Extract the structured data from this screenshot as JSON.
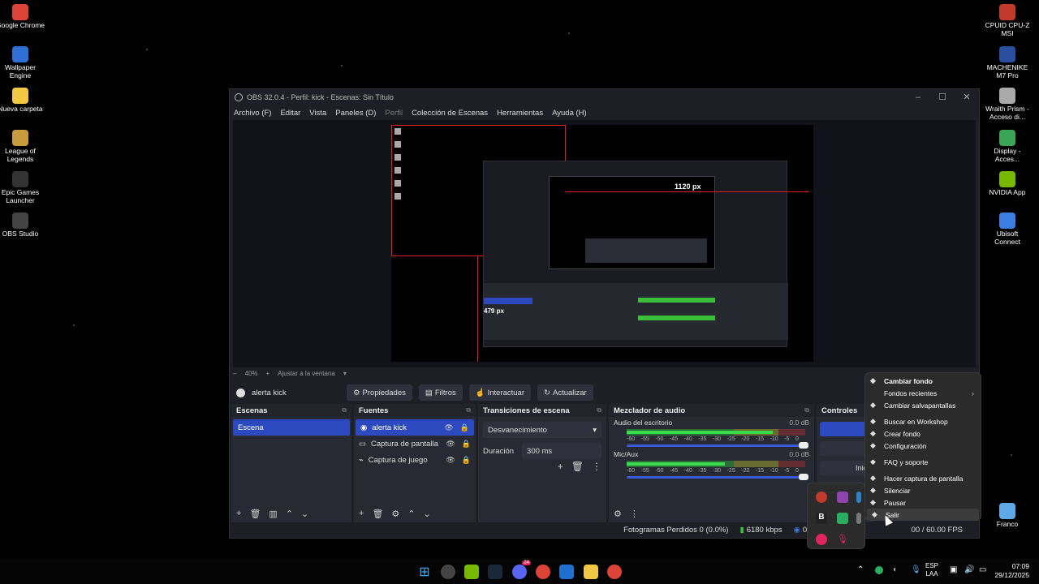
{
  "desktop_left": [
    {
      "label": "Google Chrome",
      "icon": "chrome-icon",
      "color": "#db4437"
    },
    {
      "label": "Wallpaper Engine",
      "icon": "wallpaper-engine-icon",
      "color": "#2f6fd6"
    },
    {
      "label": "Nueva carpeta",
      "icon": "folder-icon",
      "color": "#f2c744"
    },
    {
      "label": "League of Legends",
      "icon": "league-icon",
      "color": "#c89b3c"
    },
    {
      "label": "Epic Games Launcher",
      "icon": "epic-games-icon",
      "color": "#333333"
    },
    {
      "label": "OBS Studio",
      "icon": "obs-icon",
      "color": "#444444"
    }
  ],
  "desktop_right": [
    {
      "label": "CPUID CPU-Z MSI",
      "icon": "cpuz-icon",
      "color": "#c0392b"
    },
    {
      "label": "MACHENIKE M7 Pro",
      "icon": "machenike-icon",
      "color": "#2a4fa0"
    },
    {
      "label": "Wraith Prism - Acceso di...",
      "icon": "wraith-prism-icon",
      "color": "#aaaaaa"
    },
    {
      "label": "Display - Acces...",
      "icon": "display-icon",
      "color": "#3aa655"
    },
    {
      "label": "NVIDIA App",
      "icon": "nvidia-icon",
      "color": "#76b900"
    },
    {
      "label": "Ubisoft Connect",
      "icon": "ubisoft-icon",
      "color": "#3b7de0"
    },
    {
      "label": "Franco",
      "icon": "recycle-bin-icon",
      "color": "#5fa8e8"
    }
  ],
  "obs": {
    "title": "OBS 32.0.4 - Perfil: kick - Escenas: Sin Título",
    "menu": [
      "Archivo (F)",
      "Editar",
      "Vista",
      "Paneles (D)",
      "Perfil",
      "Colección de Escenas",
      "Herramientas",
      "Ayuda (H)"
    ],
    "nested_label_w": "1120 px",
    "nested_label_h": "479 px",
    "zoom": "40%",
    "zoom_fit": "Ajustar a la ventana",
    "source_name": "alerta kick",
    "toolbar": [
      "Propiedades",
      "Filtros",
      "Interactuar",
      "Actualizar"
    ],
    "scenes": {
      "title": "Escenas",
      "items": [
        "Escena"
      ]
    },
    "sources": {
      "title": "Fuentes",
      "items": [
        "alerta kick",
        "Captura de pantalla",
        "Captura de juego"
      ]
    },
    "transitions": {
      "title": "Transiciones de escena",
      "selected": "Desvanecimiento",
      "duration_label": "Duración",
      "duration_value": "300 ms"
    },
    "mixer": {
      "title": "Mezclador de audio",
      "channels": [
        {
          "name": "Audio del escritorio",
          "db": "0.0 dB",
          "level": 0.82
        },
        {
          "name": "Mic/Aux",
          "db": "0.0 dB",
          "level": 0.55
        }
      ],
      "scale": [
        "-60",
        "-55",
        "-50",
        "-45",
        "-40",
        "-35",
        "-30",
        "-25",
        "-20",
        "-15",
        "-10",
        "-5",
        "0"
      ]
    },
    "controls": {
      "title": "Controles",
      "partial": "Inic"
    },
    "status": {
      "dropped": "Fotogramas Perdidos 0 (0.0%)",
      "kbps": "6180 kbps",
      "time": "00:00",
      "fps": "00 / 60.00 FPS"
    }
  },
  "context_menu": [
    {
      "label": "Cambiar fondo",
      "icon": "wallpaper-engine-icon",
      "bold": true
    },
    {
      "label": "Fondos recientes",
      "submenu": true
    },
    {
      "label": "Cambiar salvapantallas",
      "icon": "screensaver-icon"
    },
    {
      "sep": true
    },
    {
      "label": "Buscar en Workshop",
      "icon": "workshop-icon"
    },
    {
      "label": "Crear fondo",
      "icon": "create-icon"
    },
    {
      "label": "Configuración",
      "icon": "gear-icon"
    },
    {
      "sep": true
    },
    {
      "label": "FAQ y soporte",
      "icon": "help-icon"
    },
    {
      "sep": true
    },
    {
      "label": "Hacer captura de pantalla",
      "icon": "camera-icon"
    },
    {
      "label": "Silenciar",
      "icon": "mute-icon"
    },
    {
      "label": "Pausar",
      "icon": "pause-icon"
    },
    {
      "label": "Salir",
      "icon": "power-icon",
      "hover": true
    }
  ],
  "taskbar": {
    "lang_top": "ESP",
    "lang_bottom": "LAA",
    "time": "07:09",
    "date": "29/12/2025",
    "discord_badge": "24"
  }
}
